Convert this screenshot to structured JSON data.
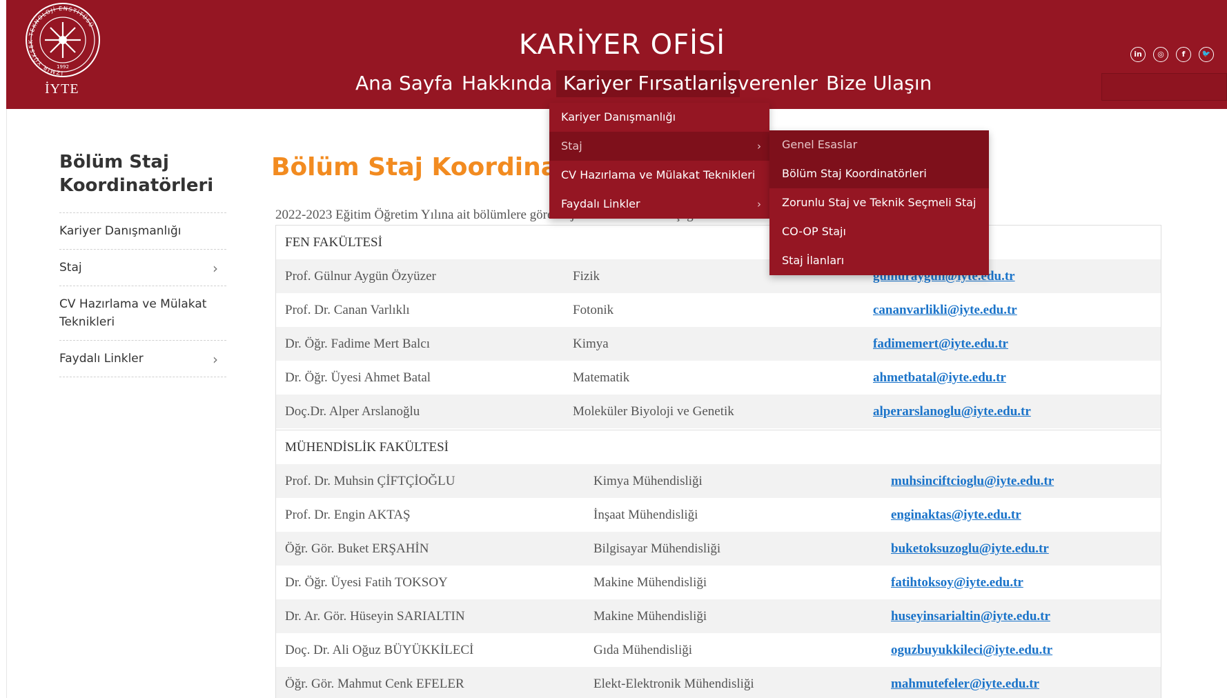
{
  "header": {
    "logo_caption": "İYTE",
    "logo_ring_text": "İZMİR YÜKSEK TEKNOLOJİ ENSTİTÜSÜ",
    "logo_year": "1992",
    "site_title": "KARİYER OFİSİ",
    "background_color": "#951623",
    "nav": [
      {
        "label": "Ana Sayfa"
      },
      {
        "label": "Hakkında"
      },
      {
        "label": "Kariyer Fırsatları"
      },
      {
        "label": "İşverenler"
      },
      {
        "label": "Bize Ulaşın"
      }
    ],
    "socials": [
      "linkedin-icon",
      "instagram-icon",
      "facebook-icon",
      "twitter-icon"
    ]
  },
  "dropdown": {
    "items": [
      {
        "label": "Kariyer Danışmanlığı"
      },
      {
        "label": "Staj"
      },
      {
        "label": "CV Hazırlama ve Mülakat Teknikleri"
      },
      {
        "label": "Faydalı Linkler"
      }
    ],
    "submenu": [
      {
        "label": "Genel Esaslar"
      },
      {
        "label": "Bölüm Staj Koordinatörleri"
      },
      {
        "label": "Zorunlu Staj ve Teknik Seçmeli Staj"
      },
      {
        "label": "CO-OP Stajı"
      },
      {
        "label": "Staj İlanları"
      }
    ]
  },
  "sidebar": {
    "title": "Bölüm Staj Koordinatörleri",
    "items": [
      {
        "label": "Kariyer Danışmanlığı"
      },
      {
        "label": "Staj"
      },
      {
        "label": "CV Hazırlama ve Mülakat Teknikleri"
      },
      {
        "label": "Faydalı Linkler"
      }
    ]
  },
  "main": {
    "title": "Bölüm Staj Koordinatör",
    "title_color": "#f28b20",
    "intro": "2022-2023 Eğitim Öğretim Yılına ait bölümlere göre staj koordinatörlerini aşağıda",
    "sections": [
      {
        "faculty": "FEN FAKÜLTESİ",
        "rows": [
          {
            "name": "Prof. Gülnur Aygün Özyüzer",
            "dept": "Fizik",
            "email": "gulnuraygun@iyte.edu.tr"
          },
          {
            "name": "Prof. Dr. Canan Varlıklı",
            "dept": "Fotonik",
            "email": "cananvarlikli@iyte.edu.tr"
          },
          {
            "name": "Dr. Öğr. Fadime Mert Balcı",
            "dept": "Kimya",
            "email": "fadimemert@iyte.edu.tr"
          },
          {
            "name": "Dr. Öğr. Üyesi Ahmet Batal",
            "dept": "Matematik",
            "email": "ahmetbatal@iyte.edu.tr"
          },
          {
            "name": "Doç.Dr. Alper Arslanoğlu",
            "dept": "Moleküler Biyoloji ve Genetik",
            "email": "alperarslanoglu@iyte.edu.tr"
          }
        ]
      },
      {
        "faculty": "MÜHENDİSLİK FAKÜLTESİ",
        "rows": [
          {
            "name": "Prof. Dr. Muhsin ÇİFTÇİOĞLU",
            "dept": "Kimya Mühendisliği",
            "email": "muhsinciftcioglu@iyte.edu.tr"
          },
          {
            "name": "Prof. Dr. Engin AKTAŞ",
            "dept": "İnşaat Mühendisliği",
            "email": "enginaktas@iyte.edu.tr"
          },
          {
            "name": "Öğr. Gör. Buket ERŞAHİN",
            "dept": "Bilgisayar Mühendisliği",
            "email": "buketoksuzoglu@iyte.edu.tr"
          },
          {
            "name": "Dr. Öğr. Üyesi Fatih TOKSOY",
            "dept": "Makine Mühendisliği",
            "email": "fatihtoksoy@iyte.edu.tr"
          },
          {
            "name": "Dr. Ar. Gör. Hüseyin SARIALTIN",
            "dept": "Makine Mühendisliği",
            "email": "huseyinsarialtin@iyte.edu.tr"
          },
          {
            "name": "Doç. Dr. Ali Oğuz BÜYÜKKİLECİ",
            "dept": "Gıda Mühendisliği",
            "email": "oguzbuyukkileci@iyte.edu.tr"
          },
          {
            "name": "Öğr. Gör. Mahmut Cenk EFELER",
            "dept": "Elekt-Elektronik Mühendisliği",
            "email": "mahmutefeler@iyte.edu.tr"
          }
        ]
      }
    ]
  }
}
